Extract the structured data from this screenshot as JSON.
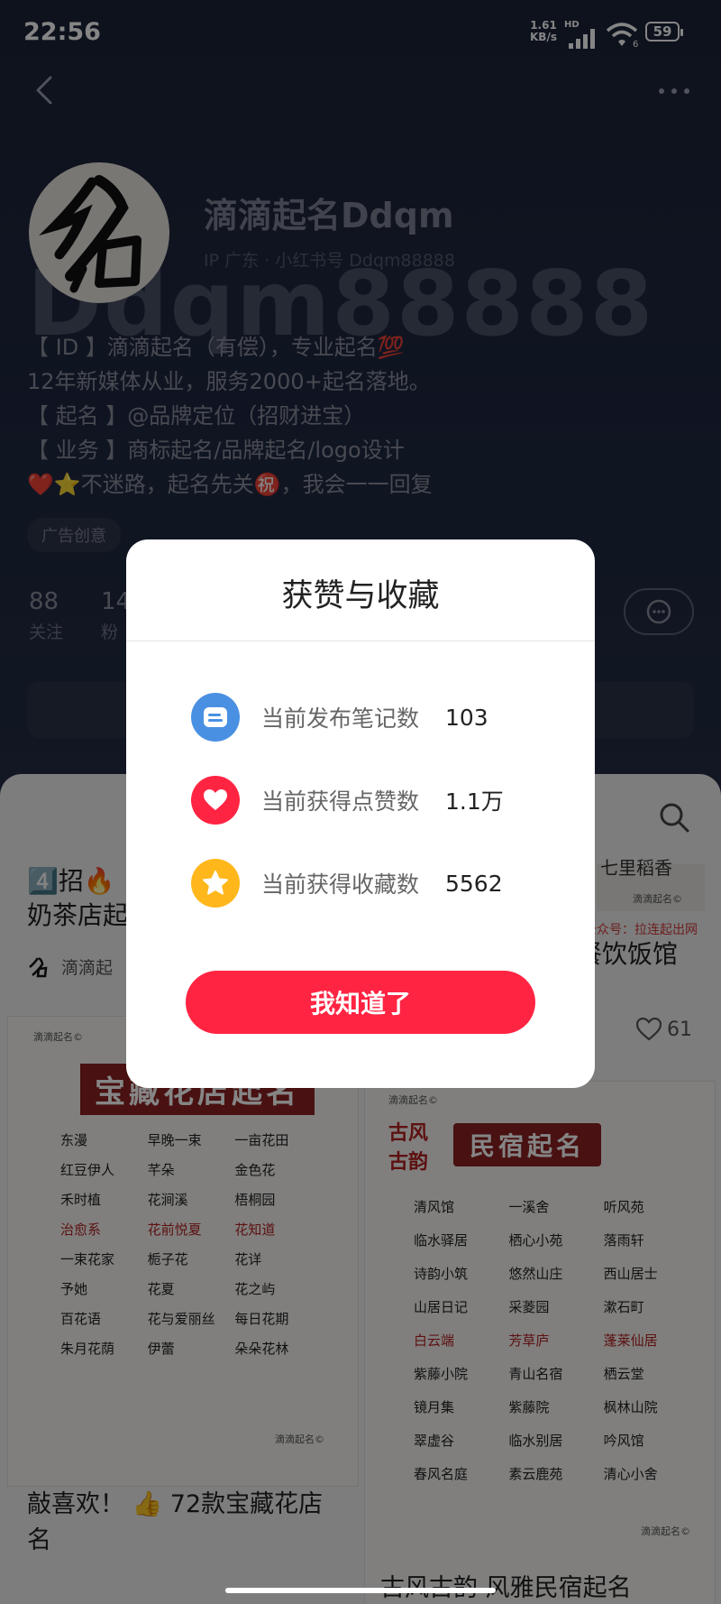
{
  "status_bar": {
    "time": "22:56",
    "net_speed_value": "1.61",
    "net_speed_unit": "KB/s",
    "hd": "HD",
    "wifi_badge": "6",
    "battery": "59"
  },
  "profile": {
    "nickname": "滴滴起名Ddqm",
    "ip_info": "IP 广东 · 小红书号 Ddqm88888",
    "background_watermark": "Ddqm88888",
    "bio_lines": [
      "【 ID 】滴滴起名（有偿），专业起名💯",
      "12年新媒体从业，服务2000+起名落地。",
      "【 起名 】@品牌定位（招财进宝）",
      "【 业务 】商标起名/品牌起名/logo设计",
      "❤️⭐不迷路，起名先关㊗️，我会一一回复"
    ],
    "tag": "广告创意",
    "stats": [
      {
        "num": "88",
        "label": "关注"
      },
      {
        "num": "14",
        "label": "粉"
      }
    ]
  },
  "feed": {
    "card1": {
      "title_line1": "4️⃣招🔥",
      "title_line2": "奶茶店起",
      "author": "滴滴起",
      "poster_title": "宝藏花店起名",
      "poster_brand": "滴滴起名©",
      "names": [
        "东漫",
        "早晚一束",
        "一亩花田",
        "红豆伊人",
        "芊朵",
        "金色花",
        "禾时植",
        "花涧溪",
        "梧桐园",
        "治愈系",
        "花前悦夏",
        "花知道",
        "一束花家",
        "栀子花",
        "花详",
        "予她",
        "花夏",
        "花之屿",
        "百花语",
        "花与爱丽丝",
        "每日花期",
        "朱月花荫",
        "伊蕾",
        "朵朵花林"
      ],
      "bottom_title_line1": "敲喜欢！ 👍 72款宝藏花店",
      "bottom_title_line2": "名"
    },
    "card2": {
      "top_text": "七里稻香",
      "top_brand": "滴滴起名©",
      "red_caption": "公众号：拉连起出网",
      "title": "餐饮饭馆",
      "likes": "61",
      "poster_left": "古风古韵",
      "poster_title": "民宿起名",
      "poster_brand": "滴滴起名©",
      "names": [
        "清风馆",
        "一溪舍",
        "听风苑",
        "临水驿居",
        "栖心小苑",
        "落雨轩",
        "诗韵小筑",
        "悠然山庄",
        "西山居士",
        "山居日记",
        "采菱园",
        "漱石町",
        "白云端",
        "芳草庐",
        "蓬莱仙居",
        "紫藤小院",
        "青山名宿",
        "栖云堂",
        "镜月集",
        "紫藤院",
        "枫林山院",
        "翠虚谷",
        "临水别居",
        "吟风馆",
        "春风名庭",
        "素云鹿苑",
        "清心小舍"
      ],
      "bottom_title": "古风古韵 风雅民宿起名"
    }
  },
  "modal": {
    "title": "获赞与收藏",
    "rows": [
      {
        "label": "当前发布笔记数",
        "value": "103",
        "icon": "note-icon",
        "color": "#4a90e2"
      },
      {
        "label": "当前获得点赞数",
        "value": "1.1万",
        "icon": "heart-icon",
        "color": "#ff2442"
      },
      {
        "label": "当前获得收藏数",
        "value": "5562",
        "icon": "star-icon",
        "color": "#ffb71b"
      }
    ],
    "button": "我知道了"
  }
}
